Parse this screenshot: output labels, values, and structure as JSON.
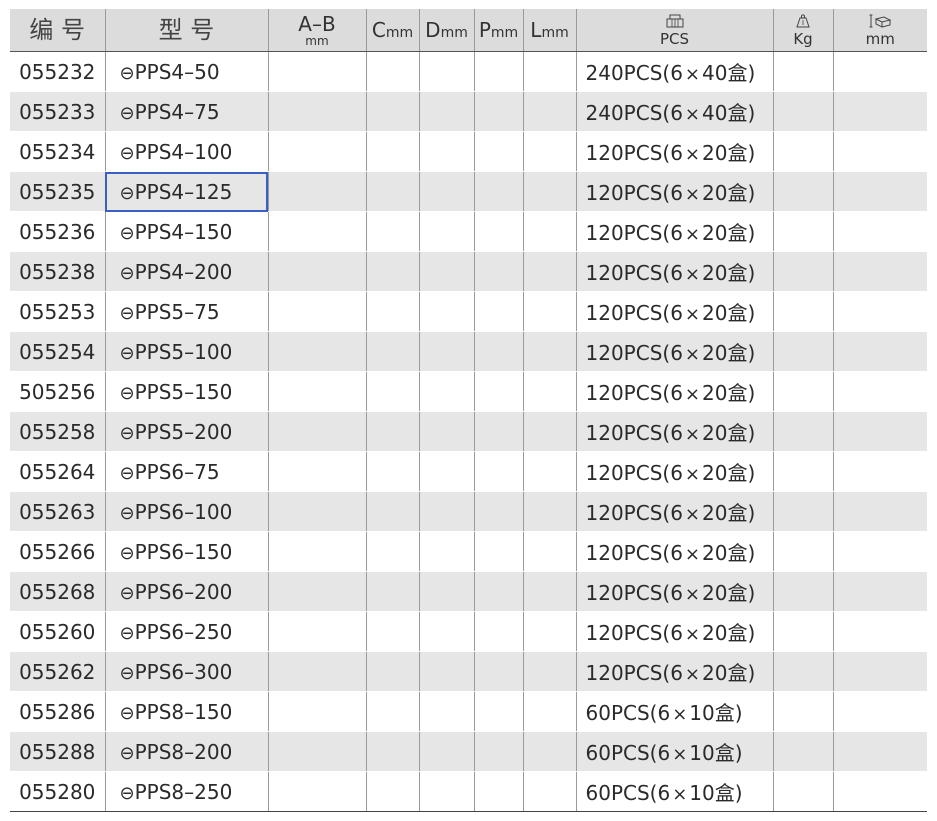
{
  "headers": {
    "code": "编 号",
    "model": "型 号",
    "ab": {
      "top": "A–B",
      "bottom": "mm"
    },
    "c": {
      "letter": "C",
      "unit": "mm"
    },
    "d": {
      "letter": "D",
      "unit": "mm"
    },
    "p": {
      "letter": "P",
      "unit": "mm"
    },
    "l": {
      "letter": "L",
      "unit": "mm"
    },
    "pcs": {
      "icon": "box-stack-icon",
      "label": "PCS"
    },
    "kg": {
      "icon": "weight-icon",
      "label": "Kg"
    },
    "size": {
      "icon": "carton-dimension-icon",
      "label": "mm"
    }
  },
  "slot_symbol": "⊖",
  "highlighted_row": 3,
  "highlight_color": "#3a5fc2",
  "rows": [
    {
      "code": "055232",
      "model": "PPS4–50",
      "pcs": "240PCS(6",
      "times": "×",
      "box": "40盒)"
    },
    {
      "code": "055233",
      "model": "PPS4–75",
      "pcs": "240PCS(6",
      "times": "×",
      "box": "40盒)"
    },
    {
      "code": "055234",
      "model": "PPS4–100",
      "pcs": "120PCS(6",
      "times": "×",
      "box": "20盒)"
    },
    {
      "code": "055235",
      "model": "PPS4–125",
      "pcs": "120PCS(6",
      "times": "×",
      "box": "20盒)"
    },
    {
      "code": "055236",
      "model": "PPS4–150",
      "pcs": "120PCS(6",
      "times": "×",
      "box": "20盒)"
    },
    {
      "code": "055238",
      "model": "PPS4–200",
      "pcs": "120PCS(6",
      "times": "×",
      "box": "20盒)"
    },
    {
      "code": "055253",
      "model": "PPS5–75",
      "pcs": "120PCS(6",
      "times": "×",
      "box": "20盒)"
    },
    {
      "code": "055254",
      "model": "PPS5–100",
      "pcs": "120PCS(6",
      "times": "×",
      "box": "20盒)"
    },
    {
      "code": "505256",
      "model": "PPS5–150",
      "pcs": "120PCS(6",
      "times": "×",
      "box": "20盒)"
    },
    {
      "code": "055258",
      "model": "PPS5–200",
      "pcs": "120PCS(6",
      "times": "×",
      "box": "20盒)"
    },
    {
      "code": "055264",
      "model": "PPS6–75",
      "pcs": "120PCS(6",
      "times": "×",
      "box": "20盒)"
    },
    {
      "code": "055263",
      "model": "PPS6–100",
      "pcs": "120PCS(6",
      "times": "×",
      "box": "20盒)"
    },
    {
      "code": "055266",
      "model": "PPS6–150",
      "pcs": "120PCS(6",
      "times": "×",
      "box": "20盒)"
    },
    {
      "code": "055268",
      "model": "PPS6–200",
      "pcs": "120PCS(6",
      "times": "×",
      "box": "20盒)"
    },
    {
      "code": "055260",
      "model": "PPS6–250",
      "pcs": "120PCS(6",
      "times": "×",
      "box": "20盒)"
    },
    {
      "code": "055262",
      "model": "PPS6–300",
      "pcs": "120PCS(6",
      "times": "×",
      "box": "20盒)"
    },
    {
      "code": "055286",
      "model": "PPS8–150",
      "pcs": "60PCS(6",
      "times": "×",
      "box": "10盒)"
    },
    {
      "code": "055288",
      "model": "PPS8–200",
      "pcs": "60PCS(6",
      "times": "×",
      "box": "10盒)"
    },
    {
      "code": "055280",
      "model": "PPS8–250",
      "pcs": "60PCS(6",
      "times": "×",
      "box": "10盒)"
    }
  ]
}
